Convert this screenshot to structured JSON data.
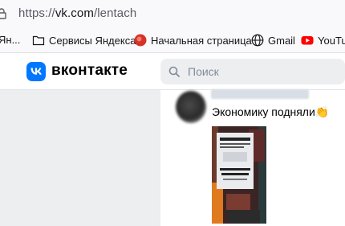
{
  "browser": {
    "url_prefix": "https://",
    "url_host": "vk.com",
    "url_path": "/lentach"
  },
  "bookmarks": [
    {
      "label": "Ян...",
      "icon": "yandex-icon"
    },
    {
      "label": "Сервисы Яндекса",
      "icon": "folder-icon"
    },
    {
      "label": "Начальная страница",
      "icon": "opera-icon"
    },
    {
      "label": "Gmail",
      "icon": "globe-icon"
    },
    {
      "label": "YouTu",
      "icon": "youtube-icon"
    }
  ],
  "header": {
    "logo_text": "VK",
    "brand": "вконтакте",
    "search_placeholder": "Поиск"
  },
  "post": {
    "text": "Экономику подняли👏",
    "photo_sign_top": "ЦЕНЫ НА ЦЕННИКАХ НЕ АКТУАЛЬНЫ",
    "photo_sign_main": "СТОИМОСТЬ ТОВАРА"
  },
  "colors": {
    "accent": "#0077ff",
    "background": "#edeef0"
  }
}
